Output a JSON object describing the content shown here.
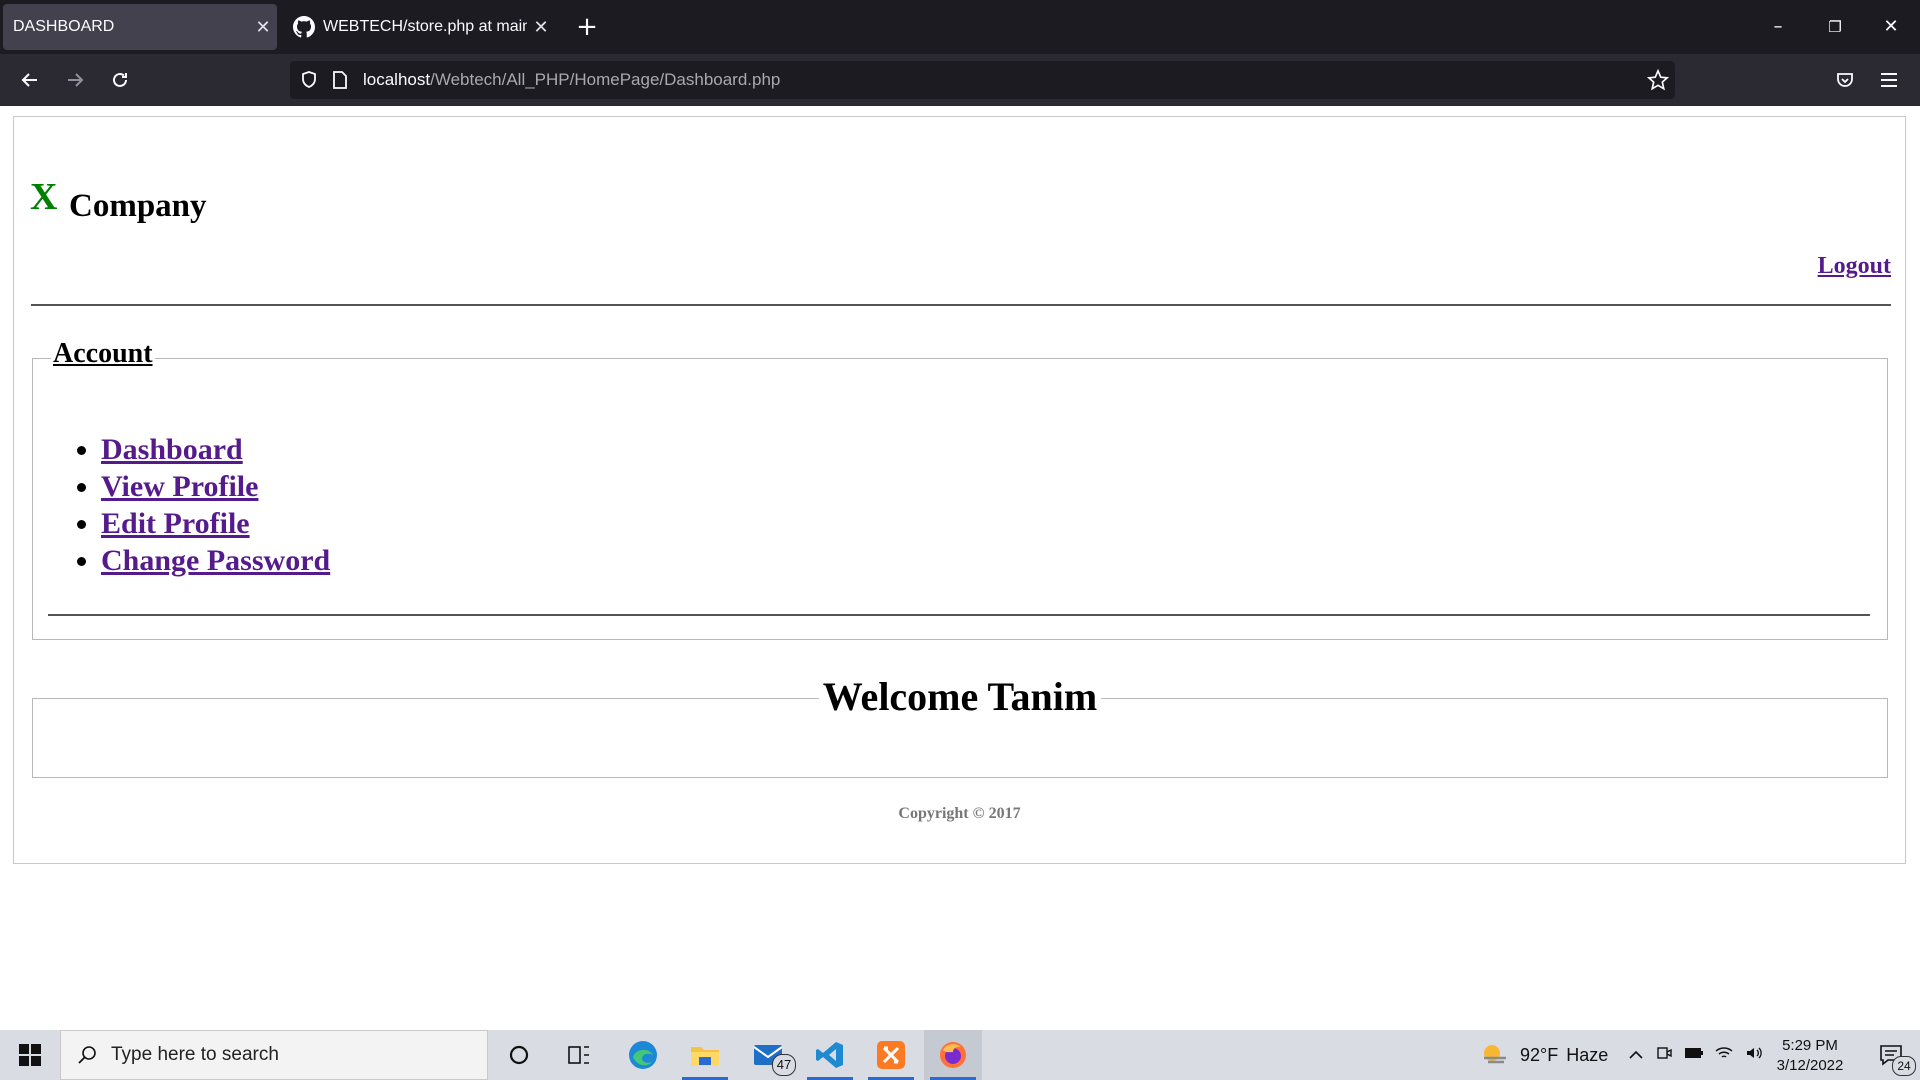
{
  "browser": {
    "tabs": [
      {
        "title": "DASHBOARD",
        "active": true
      },
      {
        "title": "WEBTECH/store.php at main · S",
        "active": false
      }
    ],
    "url": {
      "host": "localhost",
      "path": "/Webtech/All_PHP/HomePage/Dashboard.php"
    }
  },
  "page": {
    "logo_letter": "X",
    "logo_text": "Company",
    "logout_label": "Logout",
    "account_legend": "Account",
    "menu": [
      {
        "label": "Dashboard"
      },
      {
        "label": "View Profile"
      },
      {
        "label": "Edit Profile"
      },
      {
        "label": "Change Password"
      }
    ],
    "welcome": "Welcome Tanim",
    "copyright": "Copyright © 2017"
  },
  "colors": {
    "logo_x": "#008000",
    "link_visited": "#551a8b"
  },
  "taskbar": {
    "search_placeholder": "Type here to search",
    "mail_badge": "47",
    "weather": {
      "temp": "92°F",
      "condition": "Haze"
    },
    "time": "5:29 PM",
    "date": "3/12/2022",
    "notifications": "24"
  }
}
